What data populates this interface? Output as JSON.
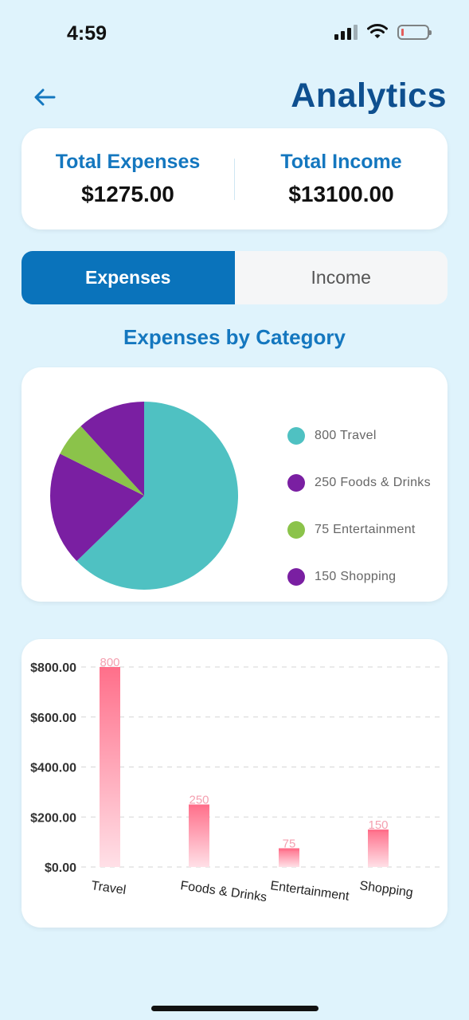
{
  "status_bar": {
    "time": "4:59"
  },
  "header": {
    "title": "Analytics"
  },
  "totals": {
    "expenses_label": "Total Expenses",
    "expenses_value": "$1275.00",
    "income_label": "Total Income",
    "income_value": "$13100.00"
  },
  "tabs": {
    "expenses": "Expenses",
    "income": "Income",
    "active": "Expenses"
  },
  "section_title": "Expenses by Category",
  "legend": [
    {
      "label": "800 Travel",
      "color": "#4fc1c2"
    },
    {
      "label": "250 Foods & Drinks",
      "color": "#7a1fa2"
    },
    {
      "label": "75 Entertainment",
      "color": "#8bc34a"
    },
    {
      "label": "150 Shopping",
      "color": "#7a1fa2"
    }
  ],
  "chart_data": [
    {
      "type": "pie",
      "categories": [
        "Travel",
        "Foods & Drinks",
        "Entertainment",
        "Shopping"
      ],
      "values": [
        800,
        250,
        75,
        150
      ],
      "colors": [
        "#4fc1c2",
        "#7a1fa2",
        "#8bc34a",
        "#7a1fa2"
      ],
      "legend_position": "right"
    },
    {
      "type": "bar",
      "categories": [
        "Travel",
        "Foods & Drinks",
        "Entertainment",
        "Shopping"
      ],
      "values": [
        800,
        250,
        75,
        150
      ],
      "value_labels": [
        "800",
        "250",
        "75",
        "150"
      ],
      "y_ticks": [
        "$0.00",
        "$200.00",
        "$400.00",
        "$600.00",
        "$800.00"
      ],
      "ylim": [
        0,
        800
      ],
      "grid": true,
      "bar_color_top": "#ff6f8a",
      "bar_color_bottom": "#ffe0e7"
    }
  ]
}
